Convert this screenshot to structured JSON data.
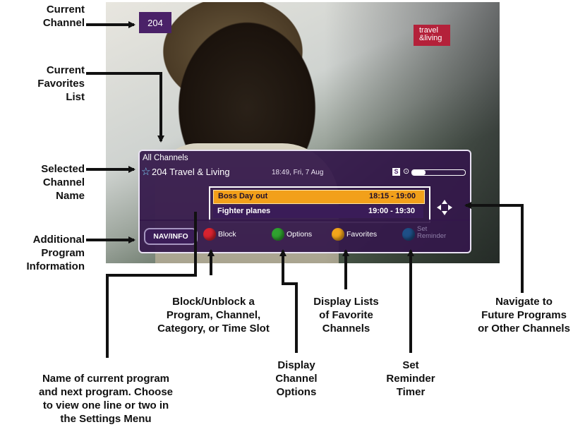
{
  "tv": {
    "channel_number": "204",
    "network_logo_line1": "travel",
    "network_logo_line2": "&living",
    "favorites_list": "All Channels",
    "selected_channel": "204 Travel & Living",
    "datetime": "18:49, Fri, 7 Aug",
    "s_badge": "S",
    "progress": 0.25,
    "programs": [
      {
        "title": "Boss Day out",
        "time": "18:15 - 19:00"
      },
      {
        "title": "Fighter planes",
        "time": "19:00 - 19:30"
      }
    ],
    "buttons": {
      "nav_info": "NAV/INFO",
      "block": "Block",
      "options": "Options",
      "favorites": "Favorites",
      "reminder_line1": "Set",
      "reminder_line2": "Reminder"
    },
    "colors": {
      "red": "#d8232f",
      "green": "#2fa12f",
      "yellow": "#f3a51b",
      "blue": "#1e4f86",
      "banner": "#34184a"
    }
  },
  "annotations": {
    "current_channel": [
      "Current",
      "Channel"
    ],
    "current_favorites": [
      "Current",
      "Favorites",
      "List"
    ],
    "selected_channel": [
      "Selected",
      "Channel",
      "Name"
    ],
    "additional_info": [
      "Additional",
      "Program",
      "Information"
    ],
    "block": [
      "Block/Unblock a",
      "Program, Channel,",
      "Category, or Time Slot"
    ],
    "favorites": [
      "Display Lists",
      "of Favorite",
      "Channels"
    ],
    "navigate": [
      "Navigate to",
      "Future Programs",
      "or Other Channels"
    ],
    "program_names": [
      "Name of current program",
      "and next program. Choose",
      "to view one line or two in",
      "the Settings Menu"
    ],
    "options": [
      "Display",
      "Channel",
      "Options"
    ],
    "reminder": [
      "Set",
      "Reminder",
      "Timer"
    ]
  }
}
